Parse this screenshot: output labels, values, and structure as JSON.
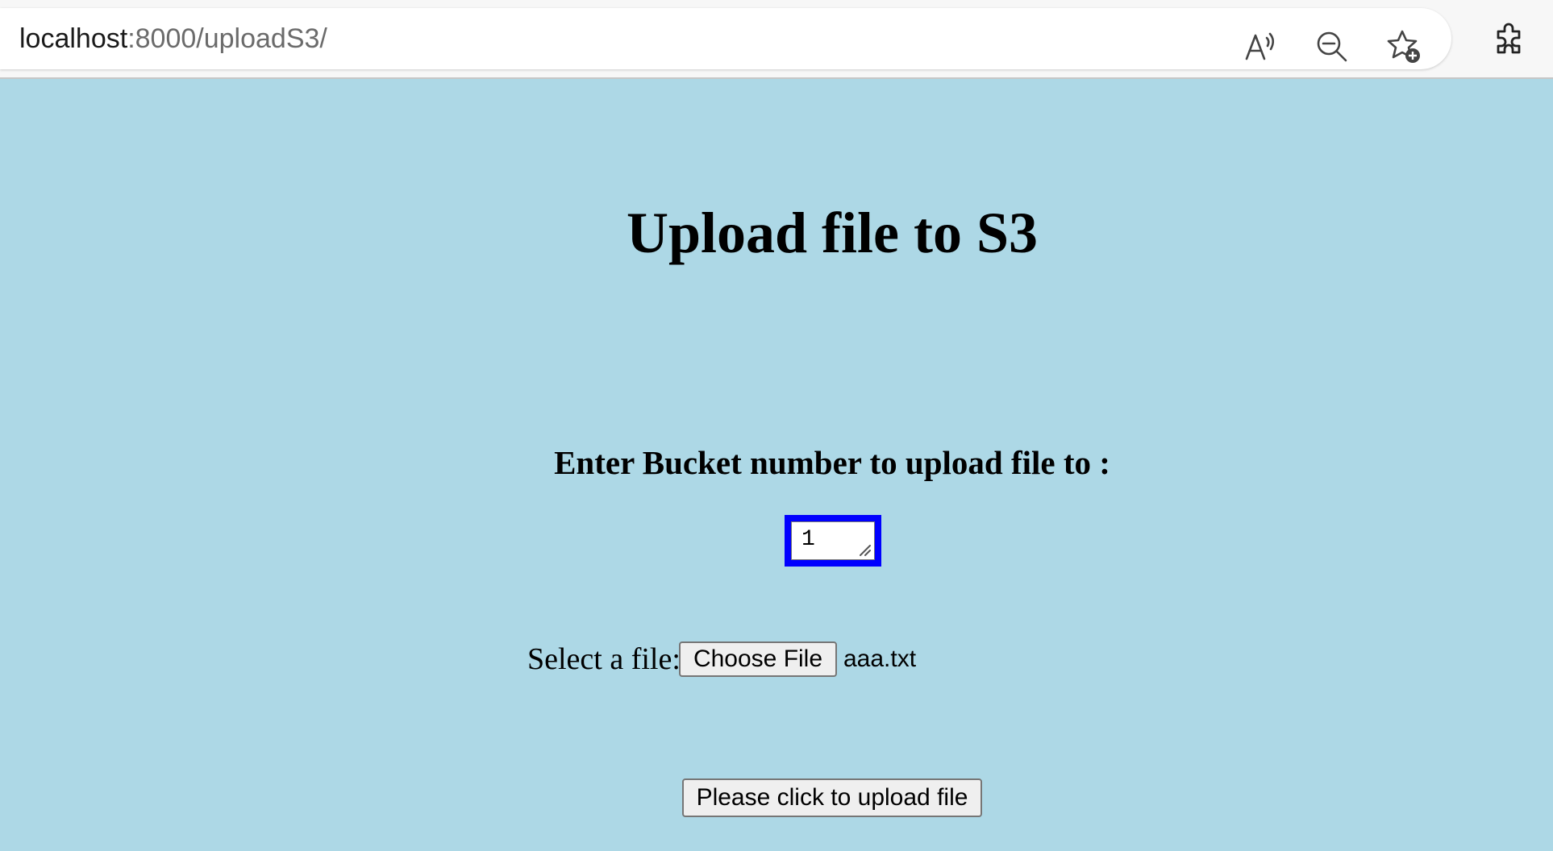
{
  "browser": {
    "url_host": "localhost",
    "url_rest": ":8000/uploadS3/",
    "toolbar_icons": [
      "read-aloud-icon",
      "zoom-out-icon",
      "add-favorite-icon",
      "extensions-icon"
    ]
  },
  "page": {
    "background_color": "#add8e6",
    "title": "Upload file to S3",
    "bucket_label": "Enter Bucket number to upload file to :",
    "bucket_value": "1",
    "focus_ring_color": "#0000ff",
    "file_label": "Select a file:",
    "choose_file_label": "Choose File",
    "chosen_file_name": "aaa.txt",
    "upload_button_label": "Please click to upload file"
  }
}
